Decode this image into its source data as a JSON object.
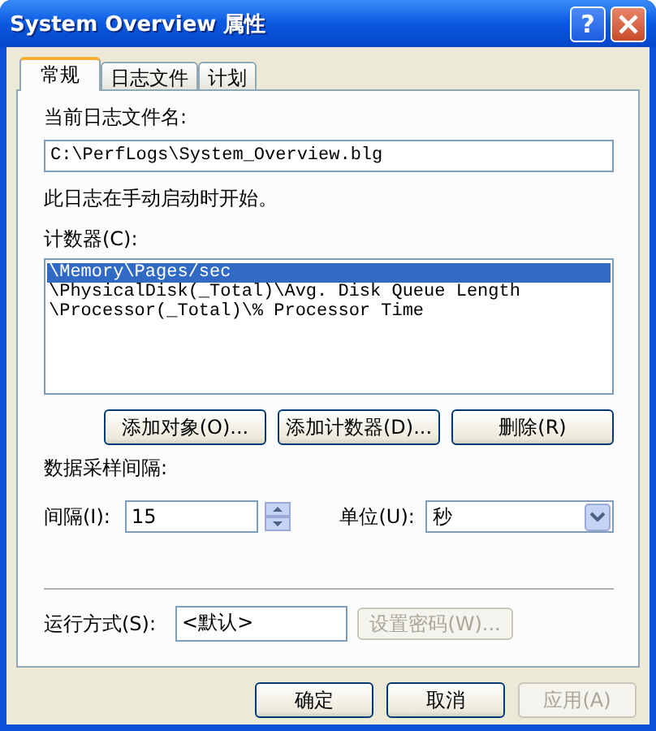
{
  "window": {
    "title": "System Overview 属性",
    "help": "?"
  },
  "tabs": [
    {
      "label": "常规",
      "selected": true
    },
    {
      "label": "日志文件",
      "selected": false
    },
    {
      "label": "计划",
      "selected": false
    }
  ],
  "log_file": {
    "label": "当前日志文件名:",
    "value": "C:\\PerfLogs\\System_Overview.blg"
  },
  "start_note": "此日志在手动启动时开始。",
  "counters": {
    "label": "计数器(C):",
    "items": [
      {
        "text": "\\Memory\\Pages/sec",
        "selected": true
      },
      {
        "text": "\\PhysicalDisk(_Total)\\Avg. Disk Queue Length",
        "selected": false
      },
      {
        "text": "\\Processor(_Total)\\% Processor Time",
        "selected": false
      }
    ],
    "buttons": [
      {
        "label": "添加对象(O)..."
      },
      {
        "label": "添加计数器(D)..."
      },
      {
        "label": "删除(R)"
      }
    ]
  },
  "sampling": {
    "label": "数据采样间隔:",
    "interval_label": "间隔(I):",
    "interval_value": "15",
    "unit_label": "单位(U):",
    "unit_value": "秒"
  },
  "run_as": {
    "label": "运行方式(S):",
    "value": "<默认>",
    "password_button": {
      "label": "设置密码(W)...",
      "disabled": true
    }
  },
  "buttons": [
    {
      "label": "确定",
      "disabled": false
    },
    {
      "label": "取消",
      "disabled": false
    },
    {
      "label": "应用(A)",
      "disabled": true
    }
  ]
}
